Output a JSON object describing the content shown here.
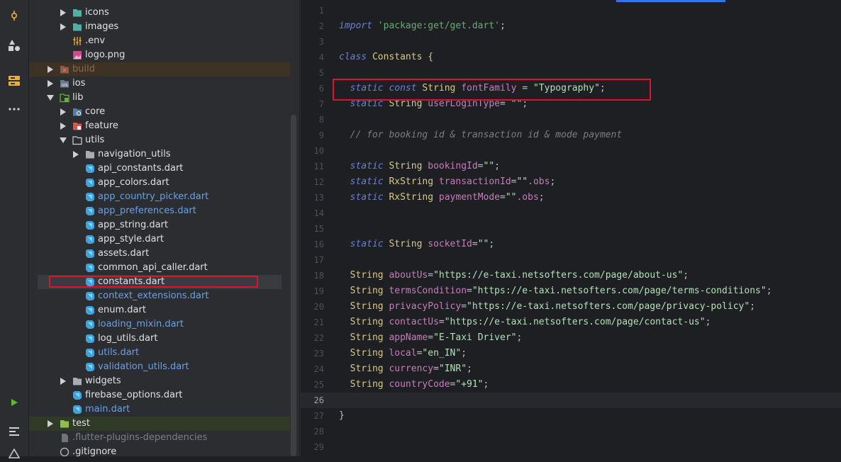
{
  "activity_bar": {
    "icons": [
      "commit-icon",
      "structure-icon",
      "database-icon",
      "more-icon",
      "run-icon",
      "log-icon",
      "warning-icon"
    ]
  },
  "project_tree": {
    "items": [
      {
        "label": "icons",
        "type": "folder-res"
      },
      {
        "label": "images",
        "type": "folder-res"
      },
      {
        "label": ".env",
        "type": "config"
      },
      {
        "label": "logo.png",
        "type": "image"
      },
      {
        "label": "build",
        "type": "folder-build"
      },
      {
        "label": "ios",
        "type": "folder-ios"
      },
      {
        "label": "lib",
        "type": "folder-src"
      },
      {
        "label": "core",
        "type": "folder-core"
      },
      {
        "label": "feature",
        "type": "folder-feature"
      },
      {
        "label": "utils",
        "type": "folder-open"
      },
      {
        "label": "navigation_utils",
        "type": "folder"
      },
      {
        "label": "api_constants.dart",
        "type": "dart"
      },
      {
        "label": "app_colors.dart",
        "type": "dart"
      },
      {
        "label": "app_country_picker.dart",
        "type": "dart-mod"
      },
      {
        "label": "app_preferences.dart",
        "type": "dart-mod"
      },
      {
        "label": "app_string.dart",
        "type": "dart"
      },
      {
        "label": "app_style.dart",
        "type": "dart"
      },
      {
        "label": "assets.dart",
        "type": "dart"
      },
      {
        "label": "common_api_caller.dart",
        "type": "dart"
      },
      {
        "label": "constants.dart",
        "type": "dart"
      },
      {
        "label": "context_extensions.dart",
        "type": "dart-mod"
      },
      {
        "label": "enum.dart",
        "type": "dart"
      },
      {
        "label": "loading_mixin.dart",
        "type": "dart-mod"
      },
      {
        "label": "log_utils.dart",
        "type": "dart"
      },
      {
        "label": "utils.dart",
        "type": "dart-mod"
      },
      {
        "label": "validation_utils.dart",
        "type": "dart-mod"
      },
      {
        "label": "widgets",
        "type": "folder"
      },
      {
        "label": "firebase_options.dart",
        "type": "dart"
      },
      {
        "label": "main.dart",
        "type": "dart-mod"
      },
      {
        "label": "test",
        "type": "folder-test"
      },
      {
        "label": ".flutter-plugins-dependencies",
        "type": "file"
      },
      {
        "label": ".gitignore",
        "type": "file"
      }
    ]
  },
  "editor": {
    "line_numbers": [
      "1",
      "2",
      "3",
      "4",
      "5",
      "6",
      "7",
      "8",
      "9",
      "10",
      "11",
      "12",
      "13",
      "14",
      "15",
      "16",
      "17",
      "18",
      "19",
      "20",
      "21",
      "22",
      "23",
      "24",
      "25",
      "26",
      "27",
      "28",
      "29"
    ],
    "code": {
      "l2_import": "import",
      "l2_path": "'package:get/get.dart'",
      "l2_end": ";",
      "l4_class": "class",
      "l4_name": " Constants {",
      "static": "static",
      "const": "const",
      "l6_type": "String",
      "l6_field": "fontFamily",
      "l6_eq": " = ",
      "l6_val": "\"Typography\"",
      "l6_end": ";",
      "l7_type": "String",
      "l7_field": "userLoginType",
      "l7_eq": "= ",
      "l7_val": "\"\"",
      "l7_end": ";",
      "l9_comment": "// for booking id & transaction id & mode payment",
      "l11_type": "String",
      "l11_field": "bookingId",
      "l11_eq": "=",
      "l11_val": "\"\"",
      "l11_end": ";",
      "l12_type": "RxString",
      "l12_field": "transactionId",
      "l12_eq": "=",
      "l12_val": "\"\"",
      "l12_obs": ".obs",
      "l12_end": ";",
      "l13_type": "RxString",
      "l13_field": "paymentMode",
      "l13_eq": "=",
      "l13_val": "\"\"",
      "l13_obs": ".obs",
      "l13_end": ";",
      "l16_type": "String",
      "l16_field": "socketId",
      "l16_eq": "=",
      "l16_val": "\"\"",
      "l16_end": ";",
      "l18_type": "String",
      "l18_field": "aboutUs",
      "l18_eq": "=",
      "l18_val": "\"https://e-taxi.netsofters.com/page/about-us\"",
      "l18_end": ";",
      "l19_type": "String",
      "l19_field": "termsCondition",
      "l19_eq": "=",
      "l19_val": "\"https://e-taxi.netsofters.com/page/terms-conditions\"",
      "l19_end": ";",
      "l20_type": "String",
      "l20_field": "privacyPolicy",
      "l20_eq": "=",
      "l20_val": "\"https://e-taxi.netsofters.com/page/privacy-policy\"",
      "l20_end": ";",
      "l21_type": "String",
      "l21_field": "contactUs",
      "l21_eq": "=",
      "l21_val": "\"https://e-taxi.netsofters.com/page/contact-us\"",
      "l21_end": ";",
      "l22_type": "String",
      "l22_field": "appName",
      "l22_eq": "=",
      "l22_val": "\"E-Taxi Driver\"",
      "l22_end": ";",
      "l23_type": "String",
      "l23_field": "local",
      "l23_eq": "=",
      "l23_val": "\"en_IN\"",
      "l23_end": ";",
      "l24_type": "String",
      "l24_field": "currency",
      "l24_eq": "=",
      "l24_val": "\"INR\"",
      "l24_end": ";",
      "l25_type": "String",
      "l25_field": "countryCode",
      "l25_eq": "=",
      "l25_val": "\"+91\"",
      "l25_end": ";",
      "l27_close": "}"
    }
  },
  "colors": {
    "highlight_box": "#e0132c",
    "accent": "#3574f0"
  }
}
